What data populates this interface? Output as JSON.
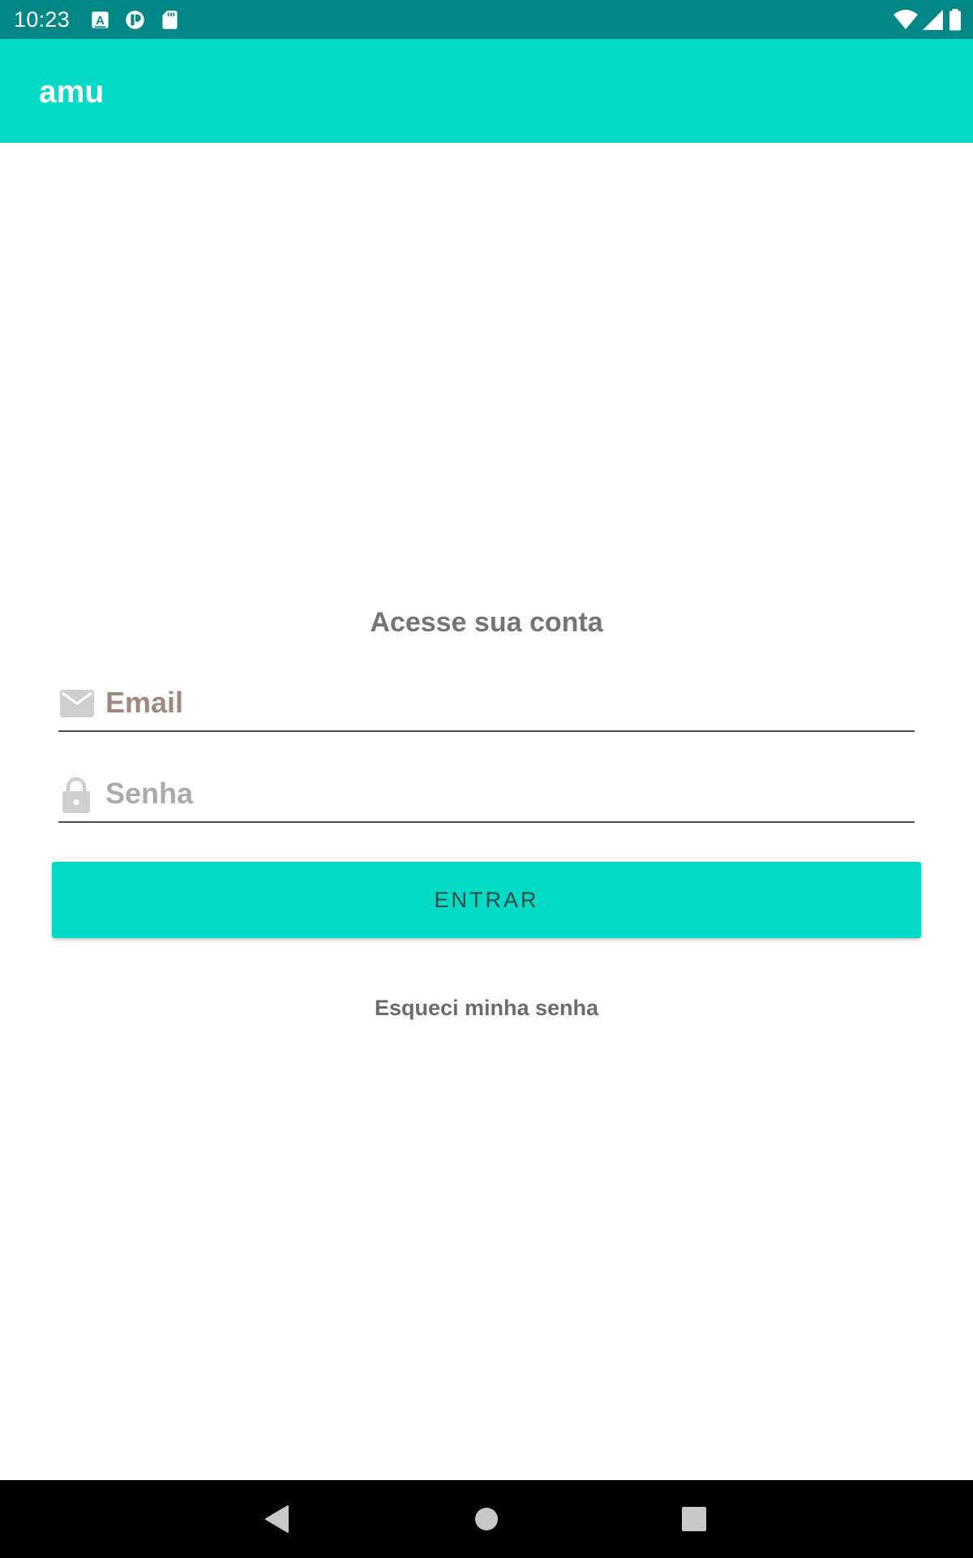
{
  "status_bar": {
    "time": "10:23",
    "left_icons": [
      "keyboard-a-icon",
      "app-notification-icon",
      "sd-card-icon"
    ],
    "right_icons": [
      "wifi-icon",
      "cellular-signal-icon",
      "battery-icon"
    ]
  },
  "app_bar": {
    "title": "amu",
    "color": "#03DAC5"
  },
  "login": {
    "heading": "Acesse sua conta",
    "email": {
      "placeholder": "Email",
      "value": "",
      "icon": "envelope-icon"
    },
    "password": {
      "placeholder": "Senha",
      "value": "",
      "icon": "lock-icon"
    },
    "submit_label": "ENTRAR",
    "forgot_label": "Esqueci minha senha"
  },
  "nav_bar": {
    "buttons": [
      "back-icon",
      "home-icon",
      "recents-icon"
    ]
  },
  "colors": {
    "status_bar": "#018786",
    "accent": "#03DAC5",
    "email_hint": "#A1887F",
    "password_hint": "#ABABAB",
    "text_muted": "#757575"
  }
}
